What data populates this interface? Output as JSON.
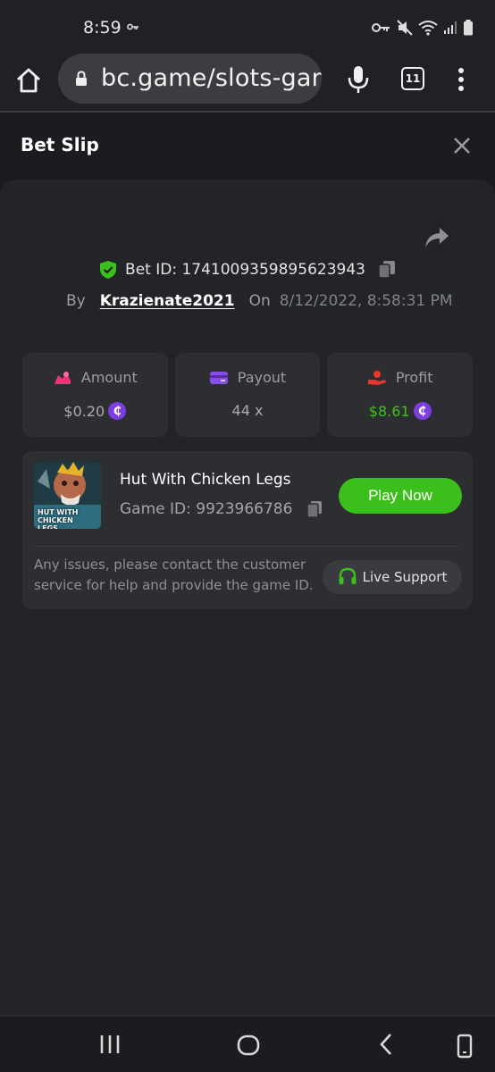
{
  "status_bar": {
    "time": "8:59"
  },
  "browser": {
    "url": "bc.game/slots-game",
    "tab_count": "11"
  },
  "header": {
    "title": "Bet Slip"
  },
  "bet": {
    "id_label": "Bet ID: 1741009359895623943",
    "by_label": "By",
    "user": "Krazienate2021",
    "on_label": "On",
    "date": "8/12/2022, 8:58:31 PM"
  },
  "stats": {
    "amount": {
      "label": "Amount",
      "value": "$0.20"
    },
    "payout": {
      "label": "Payout",
      "value": "44 x"
    },
    "profit": {
      "label": "Profit",
      "value": "$8.61"
    }
  },
  "game": {
    "name": "Hut With Chicken Legs",
    "id_label": "Game ID: 9923966786",
    "thumb_text": "HUT WITH CHICKEN LEGS",
    "play_label": "Play Now",
    "help_text": "Any issues, please contact the customer service for help and provide the game ID.",
    "support_label": "Live Support"
  },
  "colors": {
    "accent_green": "#3bbf1c",
    "coin_purple": "#7d3de0",
    "amount_icon": "#e8367a",
    "payout_icon": "#8a4ee8",
    "profit_icon": "#e8372f"
  }
}
